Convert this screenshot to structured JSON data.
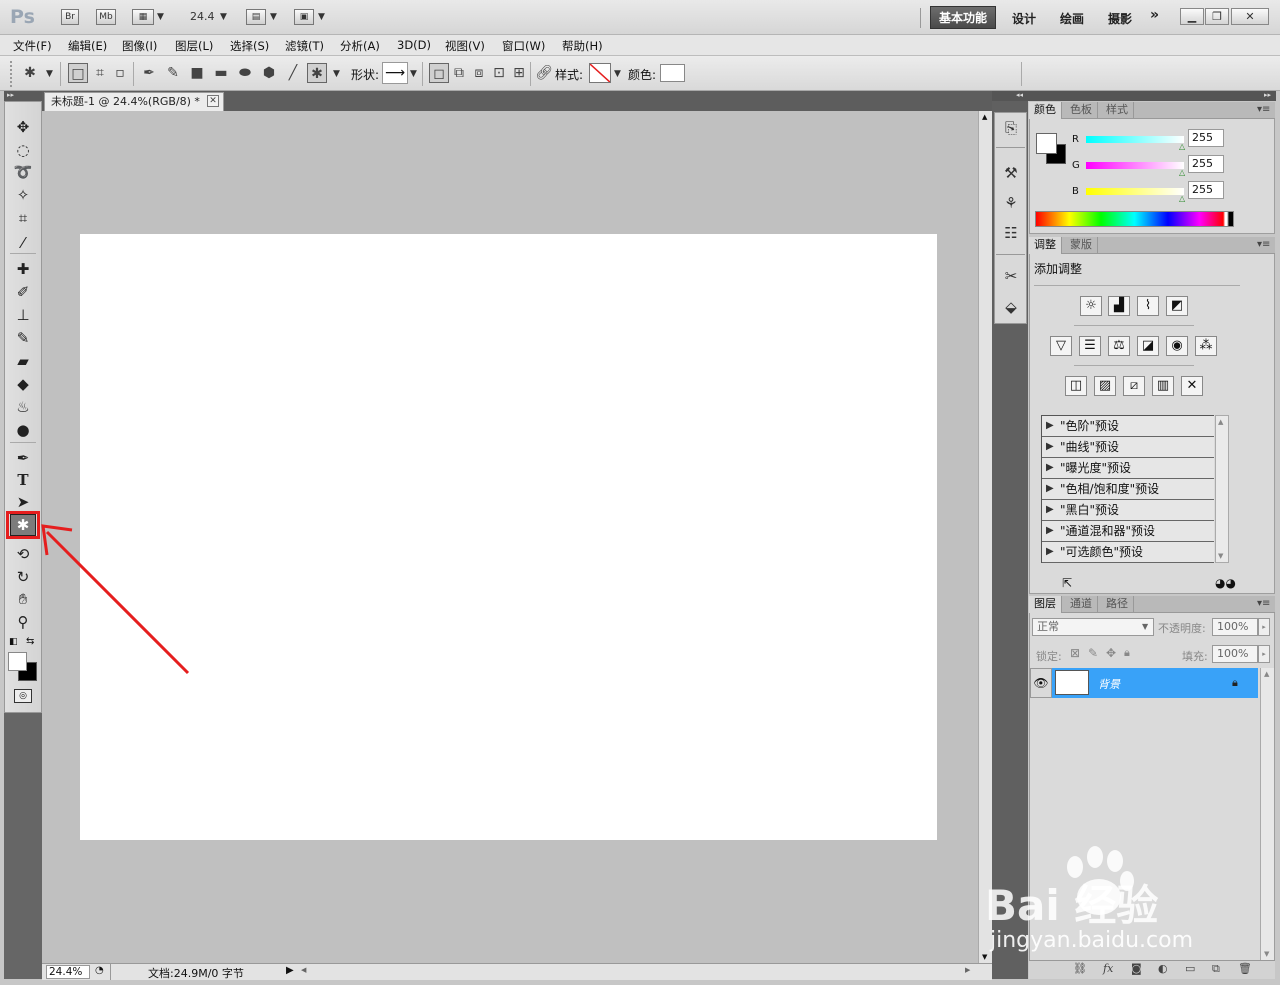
{
  "titlebar": {
    "logo": "Ps",
    "bridge": "Br",
    "minibridge": "Mb",
    "zoom": "24.4",
    "workspaces": {
      "active": "基本功能",
      "design": "设计",
      "painting": "绘画",
      "photography": "摄影",
      "more": "»"
    }
  },
  "menu": [
    "文件(F)",
    "编辑(E)",
    "图像(I)",
    "图层(L)",
    "选择(S)",
    "滤镜(T)",
    "分析(A)",
    "3D(D)",
    "视图(V)",
    "窗口(W)",
    "帮助(H)"
  ],
  "options": {
    "shape_label": "形状:",
    "style_label": "样式:",
    "color_label": "颜色:"
  },
  "document": {
    "tab_title": "未标题-1 @ 24.4%(RGB/8) *",
    "status_zoom": "24.4%",
    "status_doc": "文档:24.9M/0 字节"
  },
  "color_panel": {
    "tabs": [
      "颜色",
      "色板",
      "样式"
    ],
    "channels": [
      {
        "label": "R",
        "value": "255"
      },
      {
        "label": "G",
        "value": "255"
      },
      {
        "label": "B",
        "value": "255"
      }
    ]
  },
  "adjust_panel": {
    "tabs": [
      "调整",
      "蒙版"
    ],
    "title": "添加调整",
    "presets": [
      "\"色阶\"预设",
      "\"曲线\"预设",
      "\"曝光度\"预设",
      "\"色相/饱和度\"预设",
      "\"黑白\"预设",
      "\"通道混和器\"预设",
      "\"可选颜色\"预设"
    ]
  },
  "layers_panel": {
    "tabs": [
      "图层",
      "通道",
      "路径"
    ],
    "blend_mode": "正常",
    "opacity_label": "不透明度:",
    "opacity": "100%",
    "lock_label": "锁定:",
    "fill_label": "填充:",
    "fill": "100%",
    "layer_name": "背景"
  },
  "watermark": {
    "main": "Bai 经验",
    "sub": "jingyan.baidu.com"
  },
  "colors": {
    "accent_selected_layer": "#39a2f8",
    "annotation_red": "#e51e1e"
  }
}
